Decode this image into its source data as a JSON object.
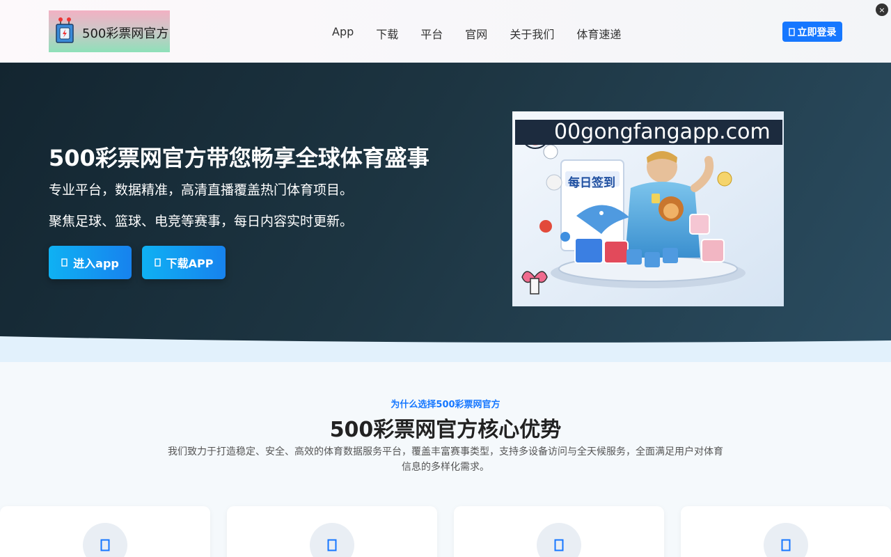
{
  "header": {
    "logo_text": "500彩票网官方",
    "nav": [
      "App",
      "下载",
      "平台",
      "官网",
      "关于我们",
      "体育速递"
    ],
    "login_label": "立即登录",
    "close_label": "×"
  },
  "hero": {
    "title": "500彩票网官方带您畅享全球体育盛事",
    "subtitle_1": "专业平台，数据精准，高清直播覆盖热门体育项目。",
    "subtitle_2": "聚焦足球、篮球、电竞等赛事，每日内容实时更新。",
    "enter_label": "进入app",
    "download_label": "下载APP",
    "promo": {
      "url": "00gongfangapp.com",
      "banner": "每日签到"
    }
  },
  "section": {
    "eyebrow": "为什么选择500彩票网官方",
    "title": "500彩票网官方核心优势",
    "description": "我们致力于打造稳定、安全、高效的体育数据服务平台，覆盖丰富赛事类型，支持多设备访问与全天候服务，全面满足用户对体育信息的多样化需求。"
  },
  "colors": {
    "accent": "#1677ff",
    "hero_bg": "#1d3542",
    "button_gradient_start": "#0fb1f3",
    "button_gradient_end": "#1782ee"
  },
  "icons": {
    "login": "login-icon",
    "enter": "app-icon",
    "download": "download-icon",
    "close": "close-icon",
    "card": "feature-icon"
  }
}
